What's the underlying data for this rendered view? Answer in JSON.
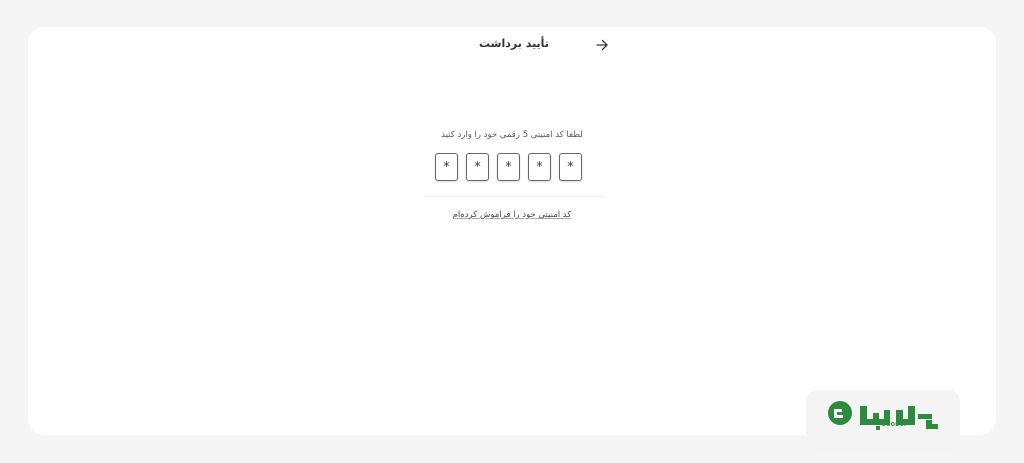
{
  "header": {
    "title": "تأیید برداشت",
    "back_icon": "arrow-right-icon"
  },
  "main": {
    "prompt": "لطفا کد امنیتی 5 رقمی خود را وارد کنید",
    "pin_mask_chars": [
      "*",
      "*",
      "*",
      "*",
      "*"
    ],
    "forgot_link": "کد امنیتی خود را فراموش کرده‌ام"
  },
  "brand": {
    "caption": "BOODUP",
    "color": "#2d8a3e"
  }
}
